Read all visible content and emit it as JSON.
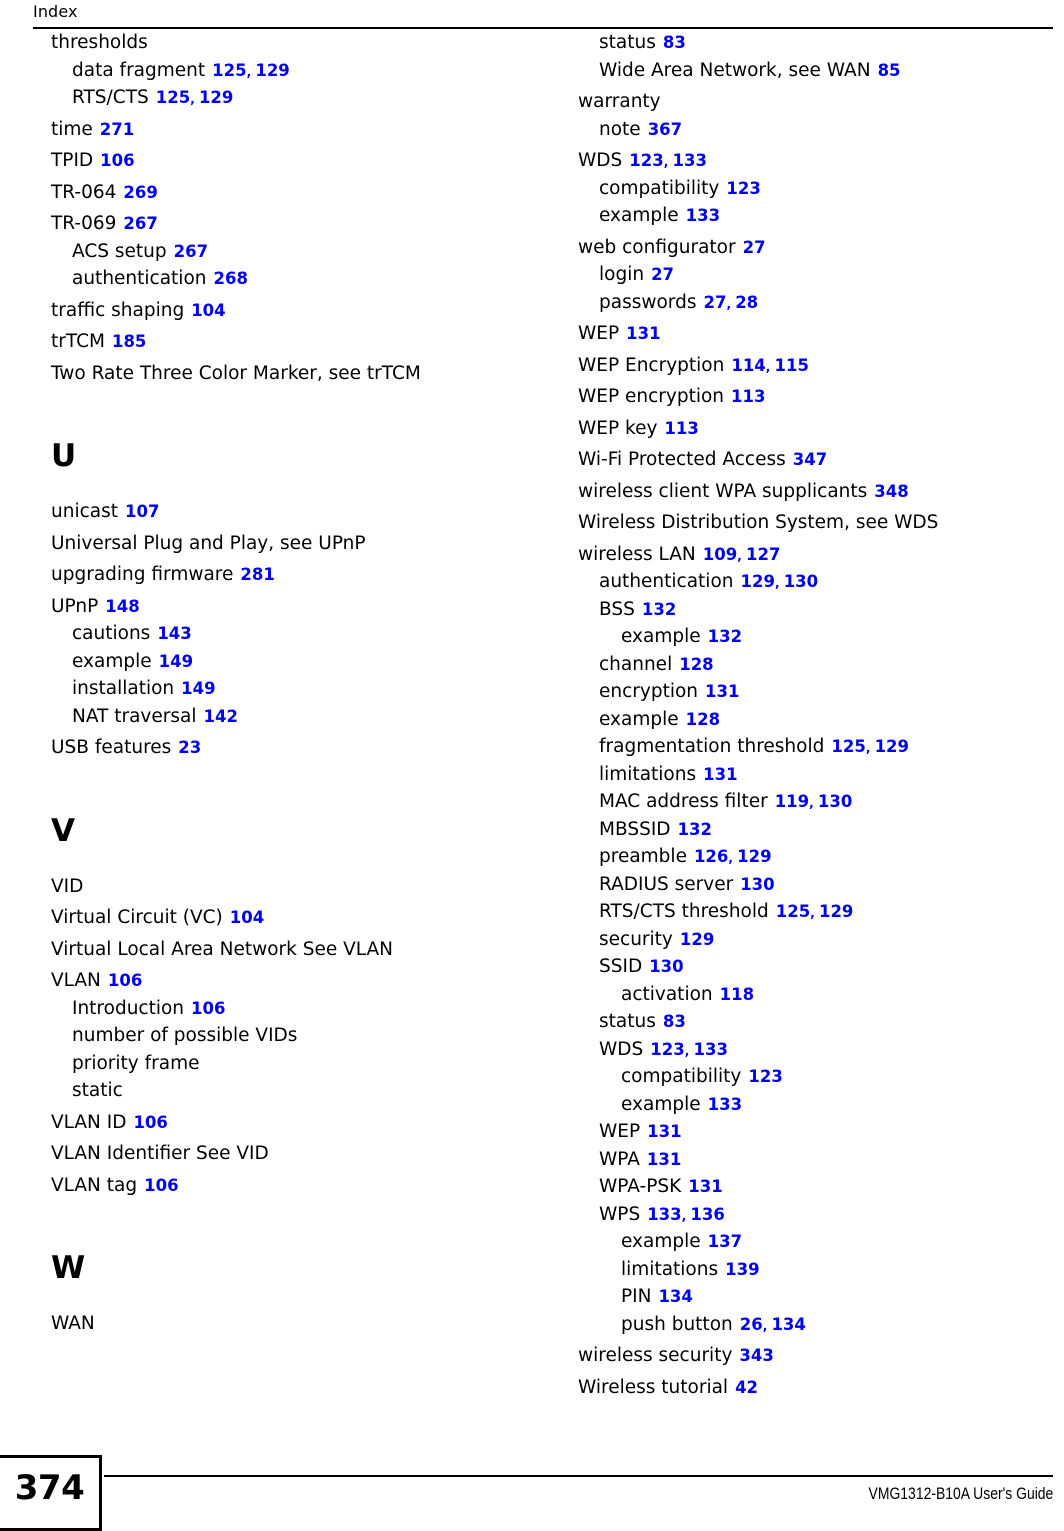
{
  "header": {
    "title": "Index"
  },
  "footer": {
    "page_number": "374",
    "guide_title": "VMG1312-B10A User's Guide"
  },
  "colors": {
    "page_number_link": "#0000f0",
    "text": "#000000",
    "background": "#ffffff"
  },
  "columns": {
    "left": [
      {
        "type": "entry",
        "level": 0,
        "label": "thresholds",
        "pages": []
      },
      {
        "type": "entry",
        "level": 1,
        "label": "data fragment",
        "pages": [
          "125",
          "129"
        ]
      },
      {
        "type": "entry",
        "level": 1,
        "label": "RTS/CTS",
        "pages": [
          "125",
          "129"
        ]
      },
      {
        "type": "entry",
        "level": 0,
        "label": "time",
        "pages": [
          "271"
        ]
      },
      {
        "type": "entry",
        "level": 0,
        "label": "TPID",
        "pages": [
          "106"
        ]
      },
      {
        "type": "entry",
        "level": 0,
        "label": "TR-064",
        "pages": [
          "269"
        ]
      },
      {
        "type": "entry",
        "level": 0,
        "label": "TR-069",
        "pages": [
          "267"
        ]
      },
      {
        "type": "entry",
        "level": 1,
        "label": "ACS setup",
        "pages": [
          "267"
        ]
      },
      {
        "type": "entry",
        "level": 1,
        "label": "authentication",
        "pages": [
          "268"
        ]
      },
      {
        "type": "entry",
        "level": 0,
        "label": "traffic shaping",
        "pages": [
          "104"
        ]
      },
      {
        "type": "entry",
        "level": 0,
        "label": "trTCM",
        "pages": [
          "185"
        ]
      },
      {
        "type": "entry",
        "level": 0,
        "label": "Two Rate Three Color Marker, see trTCM",
        "pages": []
      },
      {
        "type": "heading",
        "label": "U"
      },
      {
        "type": "entry",
        "level": 0,
        "label": "unicast",
        "pages": [
          "107"
        ]
      },
      {
        "type": "entry",
        "level": 0,
        "label": "Universal Plug and Play, see UPnP",
        "pages": []
      },
      {
        "type": "entry",
        "level": 0,
        "label": "upgrading firmware",
        "pages": [
          "281"
        ]
      },
      {
        "type": "entry",
        "level": 0,
        "label": "UPnP",
        "pages": [
          "148"
        ]
      },
      {
        "type": "entry",
        "level": 1,
        "label": "cautions",
        "pages": [
          "143"
        ]
      },
      {
        "type": "entry",
        "level": 1,
        "label": "example",
        "pages": [
          "149"
        ]
      },
      {
        "type": "entry",
        "level": 1,
        "label": "installation",
        "pages": [
          "149"
        ]
      },
      {
        "type": "entry",
        "level": 1,
        "label": "NAT traversal",
        "pages": [
          "142"
        ]
      },
      {
        "type": "entry",
        "level": 0,
        "label": "USB features",
        "pages": [
          "23"
        ]
      },
      {
        "type": "heading",
        "label": "V"
      },
      {
        "type": "entry",
        "level": 0,
        "label": "VID",
        "pages": []
      },
      {
        "type": "entry",
        "level": 0,
        "label": "Virtual Circuit (VC)",
        "pages": [
          "104"
        ]
      },
      {
        "type": "entry",
        "level": 0,
        "label": "Virtual Local Area Network See VLAN",
        "pages": []
      },
      {
        "type": "entry",
        "level": 0,
        "label": "VLAN",
        "pages": [
          "106"
        ]
      },
      {
        "type": "entry",
        "level": 1,
        "label": "Introduction",
        "pages": [
          "106"
        ]
      },
      {
        "type": "entry",
        "level": 1,
        "label": "number of possible VIDs",
        "pages": []
      },
      {
        "type": "entry",
        "level": 1,
        "label": "priority frame",
        "pages": []
      },
      {
        "type": "entry",
        "level": 1,
        "label": "static",
        "pages": []
      },
      {
        "type": "entry",
        "level": 0,
        "label": "VLAN ID",
        "pages": [
          "106"
        ]
      },
      {
        "type": "entry",
        "level": 0,
        "label": "VLAN Identifier See VID",
        "pages": []
      },
      {
        "type": "entry",
        "level": 0,
        "label": "VLAN tag",
        "pages": [
          "106"
        ]
      },
      {
        "type": "heading",
        "label": "W"
      },
      {
        "type": "entry",
        "level": 0,
        "label": "WAN",
        "pages": []
      }
    ],
    "right": [
      {
        "type": "entry",
        "level": 1,
        "label": "status",
        "pages": [
          "83"
        ]
      },
      {
        "type": "entry",
        "level": 1,
        "label": "Wide Area Network, see WAN",
        "pages": [
          "85"
        ]
      },
      {
        "type": "entry",
        "level": 0,
        "label": "warranty",
        "pages": []
      },
      {
        "type": "entry",
        "level": 1,
        "label": "note",
        "pages": [
          "367"
        ]
      },
      {
        "type": "entry",
        "level": 0,
        "label": "WDS",
        "pages": [
          "123",
          "133"
        ]
      },
      {
        "type": "entry",
        "level": 1,
        "label": "compatibility",
        "pages": [
          "123"
        ]
      },
      {
        "type": "entry",
        "level": 1,
        "label": "example",
        "pages": [
          "133"
        ]
      },
      {
        "type": "entry",
        "level": 0,
        "label": "web configurator",
        "pages": [
          "27"
        ]
      },
      {
        "type": "entry",
        "level": 1,
        "label": "login",
        "pages": [
          "27"
        ]
      },
      {
        "type": "entry",
        "level": 1,
        "label": "passwords",
        "pages": [
          "27",
          "28"
        ]
      },
      {
        "type": "entry",
        "level": 0,
        "label": "WEP",
        "pages": [
          "131"
        ]
      },
      {
        "type": "entry",
        "level": 0,
        "label": "WEP Encryption",
        "pages": [
          "114",
          "115"
        ]
      },
      {
        "type": "entry",
        "level": 0,
        "label": "WEP encryption",
        "pages": [
          "113"
        ]
      },
      {
        "type": "entry",
        "level": 0,
        "label": "WEP key",
        "pages": [
          "113"
        ]
      },
      {
        "type": "entry",
        "level": 0,
        "label": "Wi-Fi Protected Access",
        "pages": [
          "347"
        ]
      },
      {
        "type": "entry",
        "level": 0,
        "label": "wireless client WPA supplicants",
        "pages": [
          "348"
        ]
      },
      {
        "type": "entry",
        "level": 0,
        "label": "Wireless Distribution System, see WDS",
        "pages": []
      },
      {
        "type": "entry",
        "level": 0,
        "label": "wireless LAN",
        "pages": [
          "109",
          "127"
        ]
      },
      {
        "type": "entry",
        "level": 1,
        "label": "authentication",
        "pages": [
          "129",
          "130"
        ]
      },
      {
        "type": "entry",
        "level": 1,
        "label": "BSS",
        "pages": [
          "132"
        ]
      },
      {
        "type": "entry",
        "level": 2,
        "label": "example",
        "pages": [
          "132"
        ]
      },
      {
        "type": "entry",
        "level": 1,
        "label": "channel",
        "pages": [
          "128"
        ]
      },
      {
        "type": "entry",
        "level": 1,
        "label": "encryption",
        "pages": [
          "131"
        ]
      },
      {
        "type": "entry",
        "level": 1,
        "label": "example",
        "pages": [
          "128"
        ]
      },
      {
        "type": "entry",
        "level": 1,
        "label": "fragmentation threshold",
        "pages": [
          "125",
          "129"
        ]
      },
      {
        "type": "entry",
        "level": 1,
        "label": "limitations",
        "pages": [
          "131"
        ]
      },
      {
        "type": "entry",
        "level": 1,
        "label": "MAC address filter",
        "pages": [
          "119",
          "130"
        ]
      },
      {
        "type": "entry",
        "level": 1,
        "label": "MBSSID",
        "pages": [
          "132"
        ]
      },
      {
        "type": "entry",
        "level": 1,
        "label": "preamble",
        "pages": [
          "126",
          "129"
        ]
      },
      {
        "type": "entry",
        "level": 1,
        "label": "RADIUS server",
        "pages": [
          "130"
        ]
      },
      {
        "type": "entry",
        "level": 1,
        "label": "RTS/CTS threshold",
        "pages": [
          "125",
          "129"
        ]
      },
      {
        "type": "entry",
        "level": 1,
        "label": "security",
        "pages": [
          "129"
        ]
      },
      {
        "type": "entry",
        "level": 1,
        "label": "SSID",
        "pages": [
          "130"
        ]
      },
      {
        "type": "entry",
        "level": 2,
        "label": "activation",
        "pages": [
          "118"
        ]
      },
      {
        "type": "entry",
        "level": 1,
        "label": "status",
        "pages": [
          "83"
        ]
      },
      {
        "type": "entry",
        "level": 1,
        "label": "WDS",
        "pages": [
          "123",
          "133"
        ]
      },
      {
        "type": "entry",
        "level": 2,
        "label": "compatibility",
        "pages": [
          "123"
        ]
      },
      {
        "type": "entry",
        "level": 2,
        "label": "example",
        "pages": [
          "133"
        ]
      },
      {
        "type": "entry",
        "level": 1,
        "label": "WEP",
        "pages": [
          "131"
        ]
      },
      {
        "type": "entry",
        "level": 1,
        "label": "WPA",
        "pages": [
          "131"
        ]
      },
      {
        "type": "entry",
        "level": 1,
        "label": "WPA-PSK",
        "pages": [
          "131"
        ]
      },
      {
        "type": "entry",
        "level": 1,
        "label": "WPS",
        "pages": [
          "133",
          "136"
        ]
      },
      {
        "type": "entry",
        "level": 2,
        "label": "example",
        "pages": [
          "137"
        ]
      },
      {
        "type": "entry",
        "level": 2,
        "label": "limitations",
        "pages": [
          "139"
        ]
      },
      {
        "type": "entry",
        "level": 2,
        "label": "PIN",
        "pages": [
          "134"
        ]
      },
      {
        "type": "entry",
        "level": 2,
        "label": "push button",
        "pages": [
          "26",
          "134"
        ]
      },
      {
        "type": "entry",
        "level": 0,
        "label": "wireless security",
        "pages": [
          "343"
        ]
      },
      {
        "type": "entry",
        "level": 0,
        "label": "Wireless tutorial",
        "pages": [
          "42"
        ]
      }
    ]
  }
}
